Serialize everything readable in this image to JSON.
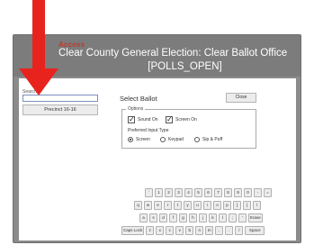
{
  "header": {
    "access_label": "Access",
    "election_title": "Clear County General Election: Clear Ballot Office",
    "polls_status": "[POLLS_OPEN]"
  },
  "left_panel": {
    "search_label": "Search",
    "search_value": "",
    "precinct_button": "Precinct 16-16"
  },
  "ballot": {
    "title": "Select Ballot",
    "close_label": "Close",
    "options_legend": "Options",
    "sound_on_label": "Sound On",
    "sound_on_checked": true,
    "screen_on_label": "Screen On",
    "screen_on_checked": true,
    "input_type_label": "Preferred Input Type",
    "input_types": [
      {
        "label": "Screen",
        "selected": true
      },
      {
        "label": "Keypad",
        "selected": false
      },
      {
        "label": "Sip & Puff",
        "selected": false
      }
    ]
  },
  "keyboard": {
    "row1": [
      "`",
      "1",
      "2",
      "3",
      "4",
      "5",
      "6",
      "7",
      "8",
      "9",
      "0",
      "-",
      "="
    ],
    "row2": [
      "q",
      "w",
      "e",
      "r",
      "t",
      "y",
      "u",
      "i",
      "o",
      "p",
      "[",
      "]",
      "\\"
    ],
    "row3": [
      "a",
      "s",
      "d",
      "f",
      "g",
      "h",
      "j",
      "k",
      "l",
      ";",
      "'",
      "Erase"
    ],
    "row4": [
      "Caps Lock",
      "z",
      "x",
      "c",
      "v",
      "b",
      "n",
      "m",
      ",",
      ".",
      "/",
      "Space"
    ]
  },
  "annotation": {
    "arrow_color": "#e8231d"
  }
}
